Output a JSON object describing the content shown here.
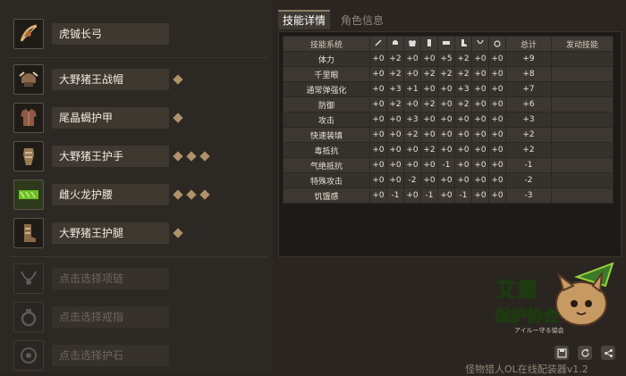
{
  "left": {
    "weapon": {
      "label": "虎铖长弓"
    },
    "armor": [
      {
        "label": "大野猪王战帽",
        "decorations": 1
      },
      {
        "label": "尾晶蝎护甲",
        "decorations": 1
      },
      {
        "label": "大野猪王护手",
        "decorations": 3
      },
      {
        "label": "雌火龙护腰",
        "decorations": 3
      },
      {
        "label": "大野猪王护腿",
        "decorations": 1
      }
    ],
    "empty": [
      {
        "label": "点击选择项链"
      },
      {
        "label": "点击选择戒指"
      },
      {
        "label": "点击选择护石"
      }
    ]
  },
  "tabs": {
    "skill_detail": "技能详情",
    "char_info": "角色信息"
  },
  "skill_table": {
    "headers": {
      "skill": "技能系统",
      "total": "总计",
      "active": "发动技能"
    },
    "part_icons": [
      "weapon-icon",
      "helm-icon",
      "chest-icon",
      "arm-icon",
      "waist-icon",
      "leg-icon",
      "necklace-icon",
      "ring-icon"
    ],
    "rows": [
      {
        "name": "体力",
        "v": [
          "+0",
          "+2",
          "+0",
          "+0",
          "+5",
          "+2",
          "+0",
          "+0"
        ],
        "total": "+9",
        "active": ""
      },
      {
        "name": "千里眼",
        "v": [
          "+0",
          "+2",
          "+0",
          "+2",
          "+2",
          "+2",
          "+0",
          "+0"
        ],
        "total": "+8",
        "active": ""
      },
      {
        "name": "通常弹强化",
        "v": [
          "+0",
          "+3",
          "+1",
          "+0",
          "+0",
          "+3",
          "+0",
          "+0"
        ],
        "total": "+7",
        "active": ""
      },
      {
        "name": "防御",
        "v": [
          "+0",
          "+2",
          "+0",
          "+2",
          "+0",
          "+2",
          "+0",
          "+0"
        ],
        "total": "+6",
        "active": ""
      },
      {
        "name": "攻击",
        "v": [
          "+0",
          "+0",
          "+3",
          "+0",
          "+0",
          "+0",
          "+0",
          "+0"
        ],
        "total": "+3",
        "active": ""
      },
      {
        "name": "快速装填",
        "v": [
          "+0",
          "+0",
          "+2",
          "+0",
          "+0",
          "+0",
          "+0",
          "+0"
        ],
        "total": "+2",
        "active": ""
      },
      {
        "name": "毒抵抗",
        "v": [
          "+0",
          "+0",
          "+0",
          "+2",
          "+0",
          "+0",
          "+0",
          "+0"
        ],
        "total": "+2",
        "active": ""
      },
      {
        "name": "气绝抵抗",
        "v": [
          "+0",
          "+0",
          "+0",
          "+0",
          "-1",
          "+0",
          "+0",
          "+0"
        ],
        "total": "-1",
        "active": ""
      },
      {
        "name": "特殊攻击",
        "v": [
          "+0",
          "+0",
          "-2",
          "+0",
          "+0",
          "+0",
          "+0",
          "+0"
        ],
        "total": "-2",
        "active": ""
      },
      {
        "name": "饥饿感",
        "v": [
          "+0",
          "-1",
          "+0",
          "-1",
          "+0",
          "-1",
          "+0",
          "+0"
        ],
        "total": "-3",
        "active": ""
      }
    ]
  },
  "logo": {
    "main": "艾露猫保护协会",
    "sub": "アイルー守る協会"
  },
  "footer": {
    "text": "怪物猎人OL在线配装器v1.2"
  },
  "colors": {
    "bg": "#2a2520",
    "panel": "#1d1b18",
    "accent": "#b0916a",
    "logo_green": "#9ad23a"
  }
}
